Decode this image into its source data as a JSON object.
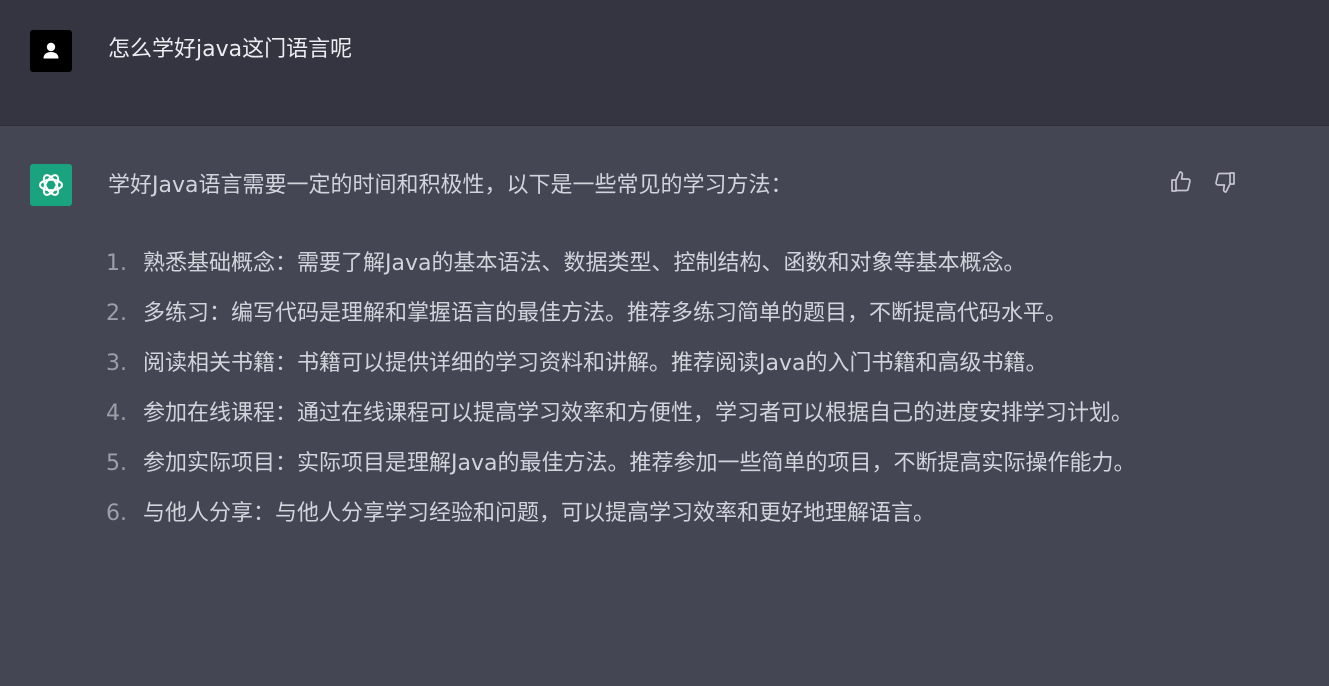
{
  "conversation": {
    "user": {
      "avatar_icon": "user-silhouette-icon",
      "message": "怎么学好java这门语言呢"
    },
    "assistant": {
      "avatar_icon": "openai-logo-icon",
      "intro": "学好Java语言需要一定的时间和积极性，以下是一些常见的学习方法：",
      "tips": [
        {
          "num": "1.",
          "text": "熟悉基础概念：需要了解Java的基本语法、数据类型、控制结构、函数和对象等基本概念。"
        },
        {
          "num": "2.",
          "text": "多练习：编写代码是理解和掌握语言的最佳方法。推荐多练习简单的题目，不断提高代码水平。"
        },
        {
          "num": "3.",
          "text": "阅读相关书籍：书籍可以提供详细的学习资料和讲解。推荐阅读Java的入门书籍和高级书籍。"
        },
        {
          "num": "4.",
          "text": "参加在线课程：通过在线课程可以提高学习效率和方便性，学习者可以根据自己的进度安排学习计划。"
        },
        {
          "num": "5.",
          "text": "参加实际项目：实际项目是理解Java的最佳方法。推荐参加一些简单的项目，不断提高实际操作能力。"
        },
        {
          "num": "6.",
          "text": "与他人分享：与他人分享学习经验和问题，可以提高学习效率和更好地理解语言。"
        }
      ],
      "feedback_icons": [
        "thumbs-up-icon",
        "thumbs-down-icon"
      ]
    }
  },
  "colors": {
    "user_row_bg": "#343541",
    "assistant_row_bg": "#444654",
    "assistant_avatar_bg": "#19a37f",
    "text_primary": "#ececf1",
    "text_secondary": "#d1d5db",
    "list_number": "#9aa0a8"
  }
}
